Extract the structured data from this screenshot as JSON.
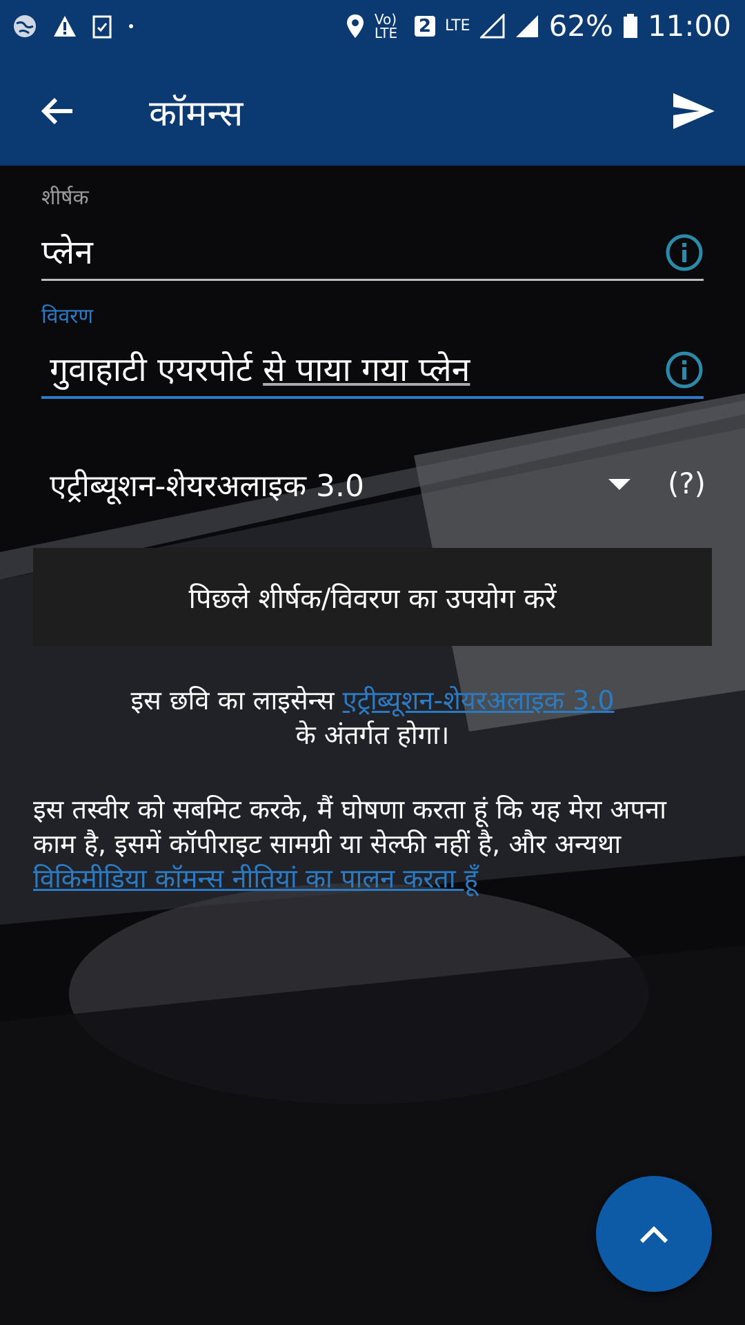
{
  "status_bar": {
    "icons_left": [
      "globe-icon",
      "warning-icon",
      "checklist-icon",
      "dot-icon"
    ],
    "volte": "Vo) LTE",
    "sim": "2",
    "network": "LTE",
    "battery_percent": "62%",
    "time": "11:00"
  },
  "app_bar": {
    "title": "कॉमन्स",
    "back_icon": "arrow-left-icon",
    "send_icon": "send-icon"
  },
  "form": {
    "title_label": "शीर्षक",
    "title_value": "प्लेन",
    "description_label": "विवरण",
    "description_value_plain": "गुवाहाटी एयरपोर्ट ",
    "description_value_underlined": "से पाया गया प्लेन",
    "license_selected": "एट्रीब्यूशन-शेयरअलाइक 3.0",
    "license_help": "(?)",
    "prev_button": "पिछले शीर्षक/विवरण का उपयोग करें"
  },
  "license_notice": {
    "prefix": "इस छवि का लाइसेन्स ",
    "link": "एट्रीब्यूशन-शेयरअलाइक 3.0",
    "suffix": "के अंतर्गत होगा।"
  },
  "declaration": {
    "text": "इस तस्वीर को सबमिट करके, मैं घोषणा करता हूं कि यह मेरा अपना काम है, इसमें कॉपीराइट सामग्री या सेल्फी नहीं है, और अन्यथा ",
    "link": "विकिमीडिया कॉमन्स नीतियां का पालन करता हूँ"
  },
  "colors": {
    "primary": "#0b3a72",
    "accent": "#2b7bc4",
    "info_icon": "#2a8aa8",
    "fab": "#0d5aa7"
  }
}
